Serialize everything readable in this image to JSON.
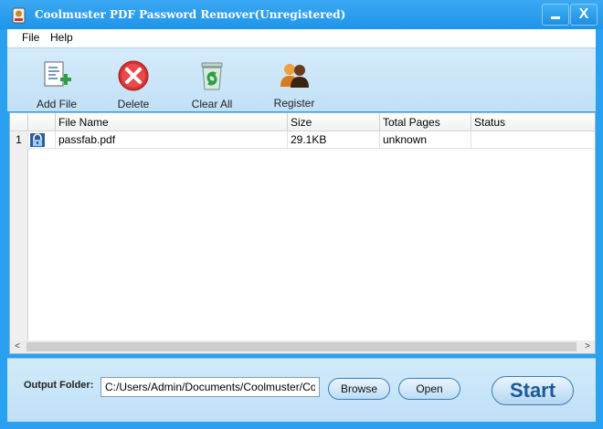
{
  "window": {
    "title": "Coolmuster PDF Password Remover(Unregistered)",
    "minimize_icon": "minimize-icon",
    "close_icon": "close-icon",
    "close_glyph": "X"
  },
  "menu": {
    "items": [
      "File",
      "Help"
    ]
  },
  "toolbar": {
    "add_file": "Add File",
    "delete": "Delete",
    "clear_all": "Clear All",
    "register": "Register"
  },
  "table": {
    "columns": [
      "File Name",
      "Size",
      "Total Pages",
      "Status"
    ],
    "rows": [
      {
        "index": "1",
        "icon": "lock-icon",
        "file_name": "passfab.pdf",
        "size": "29.1KB",
        "total_pages": "unknown",
        "status": ""
      }
    ]
  },
  "scroll": {
    "left": "<",
    "right": ">"
  },
  "output": {
    "label": "Output Folder:",
    "value": "C:/Users/Admin/Documents/Coolmuster/Coolmuster PDF Password Remover",
    "browse": "Browse",
    "open": "Open",
    "start": "Start"
  },
  "colors": {
    "title_bar": "#1f95ea",
    "toolbar_bg": "#c2e0f7",
    "start_text": "#1a5a95"
  }
}
